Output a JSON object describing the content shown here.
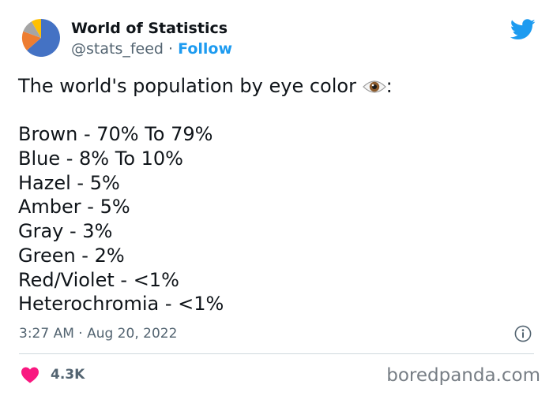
{
  "tweet": {
    "author_name": "World of Statistics",
    "handle": "@stats_feed",
    "separator": "·",
    "follow_label": "Follow",
    "intro": "The world's population by eye color",
    "intro_suffix": ":",
    "eye_emoji": "eye-emoji-icon",
    "lines": [
      "Brown - 70% To 79%",
      "Blue - 8% To 10%",
      "Hazel - 5%",
      "Amber - 5%",
      "Gray - 3%",
      "Green - 2%",
      "Red/Violet - <1%",
      "Heterochromia - <1%"
    ],
    "timestamp": "3:27 AM · Aug 20, 2022",
    "like_count": "4.3K"
  },
  "watermark": "boredpanda.com",
  "icons": {
    "avatar": "pie-chart-avatar",
    "logo": "twitter-bird-icon",
    "info": "info-icon",
    "like": "heart-icon"
  },
  "colors": {
    "accent": "#1d9bf0",
    "heart": "#f91880",
    "muted": "#536471",
    "text": "#0f1419"
  }
}
